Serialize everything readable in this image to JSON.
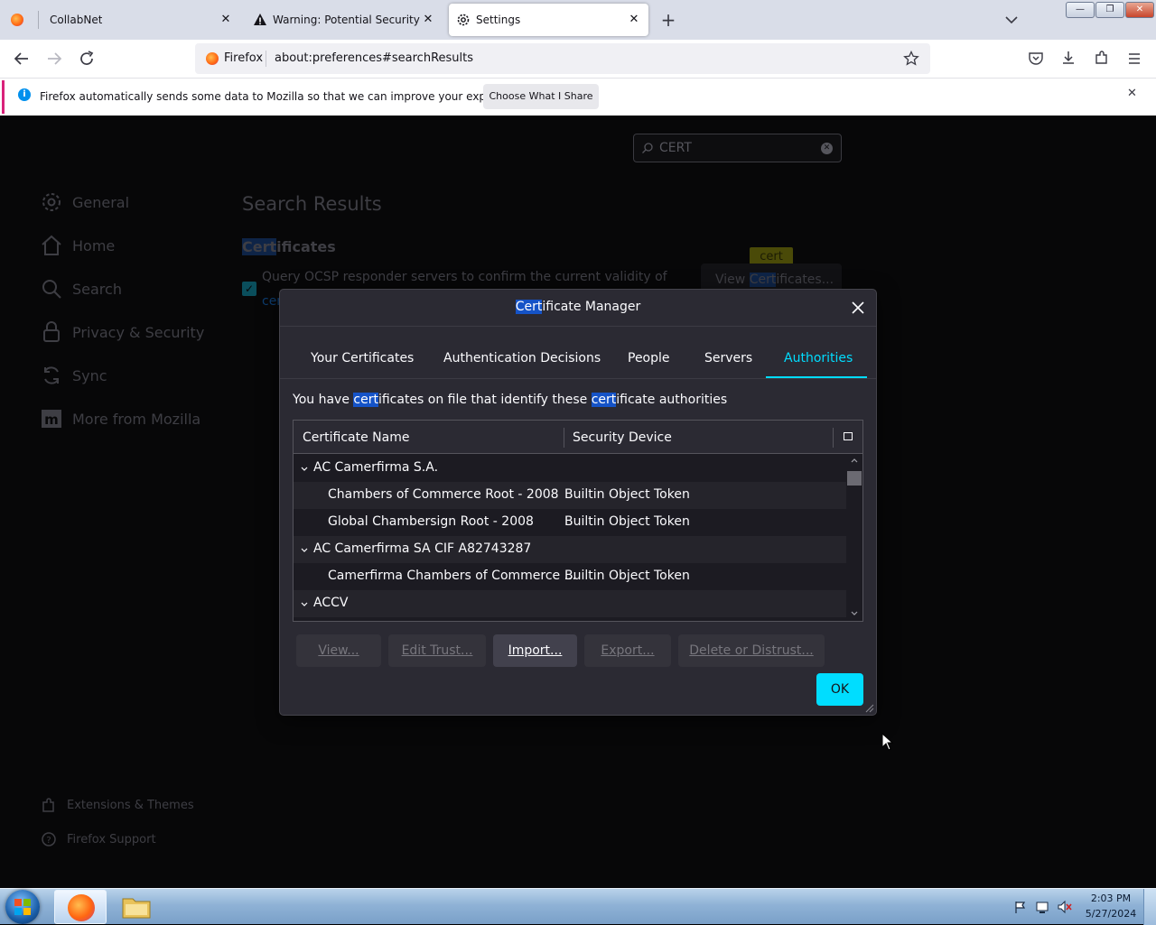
{
  "tabs": [
    {
      "title": "CollabNet"
    },
    {
      "title": "Warning: Potential Security Risk"
    },
    {
      "title": "Settings"
    }
  ],
  "window_controls": {
    "minimize": "—",
    "restore": "❐",
    "close": "✕"
  },
  "navbar": {
    "identity_label": "Firefox",
    "url": "about:preferences#searchResults"
  },
  "notification": {
    "message": "Firefox automatically sends some data to Mozilla so that we can improve your experience.",
    "button_label": "Choose What I Share"
  },
  "search": {
    "value": "CERT"
  },
  "sidebar": {
    "items": [
      {
        "label": "General"
      },
      {
        "label": "Home"
      },
      {
        "label": "Search"
      },
      {
        "label": "Privacy & Security"
      },
      {
        "label": "Sync"
      },
      {
        "label": "More from Mozilla"
      }
    ],
    "footer": [
      {
        "label": "Extensions & Themes"
      },
      {
        "label": "Firefox Support"
      }
    ]
  },
  "main": {
    "heading": "Search Results",
    "section_prefix": "Cert",
    "section_suffix": "ificates",
    "ocsp_text": "Query OCSP responder servers to confirm the current validity of",
    "ocsp_text2": "cer",
    "tooltip": "cert",
    "view_btn_prefix": "View ",
    "view_btn_hl": "Cert",
    "view_btn_suffix": "ificates..."
  },
  "dialog": {
    "title_hl": "Cert",
    "title_rest": "ificate Manager",
    "tabs": [
      {
        "label": "Your Certificates"
      },
      {
        "label": "Authentication Decisions"
      },
      {
        "label": "People"
      },
      {
        "label": "Servers"
      },
      {
        "label": "Authorities"
      }
    ],
    "intro_1": "You have ",
    "intro_hl1": "cert",
    "intro_2": "ificates on file that identify these ",
    "intro_hl2": "cert",
    "intro_3": "ificate authorities",
    "columns": {
      "name": "Certificate Name",
      "device": "Security Device"
    },
    "rows": [
      {
        "name": "AC Camerfirma S.A.",
        "device": ""
      },
      {
        "name": "Chambers of Commerce Root - 2008",
        "device": "Builtin Object Token"
      },
      {
        "name": "Global Chambersign Root - 2008",
        "device": "Builtin Object Token"
      },
      {
        "name": "AC Camerfirma SA CIF A82743287",
        "device": ""
      },
      {
        "name": "Camerfirma Chambers of Commerce ...",
        "device": "Builtin Object Token"
      },
      {
        "name": "ACCV",
        "device": ""
      }
    ],
    "buttons": {
      "view": "View...",
      "edit_trust": "Edit Trust...",
      "import": "Import...",
      "export": "Export...",
      "delete": "Delete or Distrust...",
      "ok": "OK"
    }
  },
  "clock": {
    "time": "2:03 PM",
    "date": "5/27/2024"
  },
  "colors": {
    "accent": "#00ddff",
    "highlight": "#1553c7",
    "dialog_bg": "#2b2a33"
  }
}
